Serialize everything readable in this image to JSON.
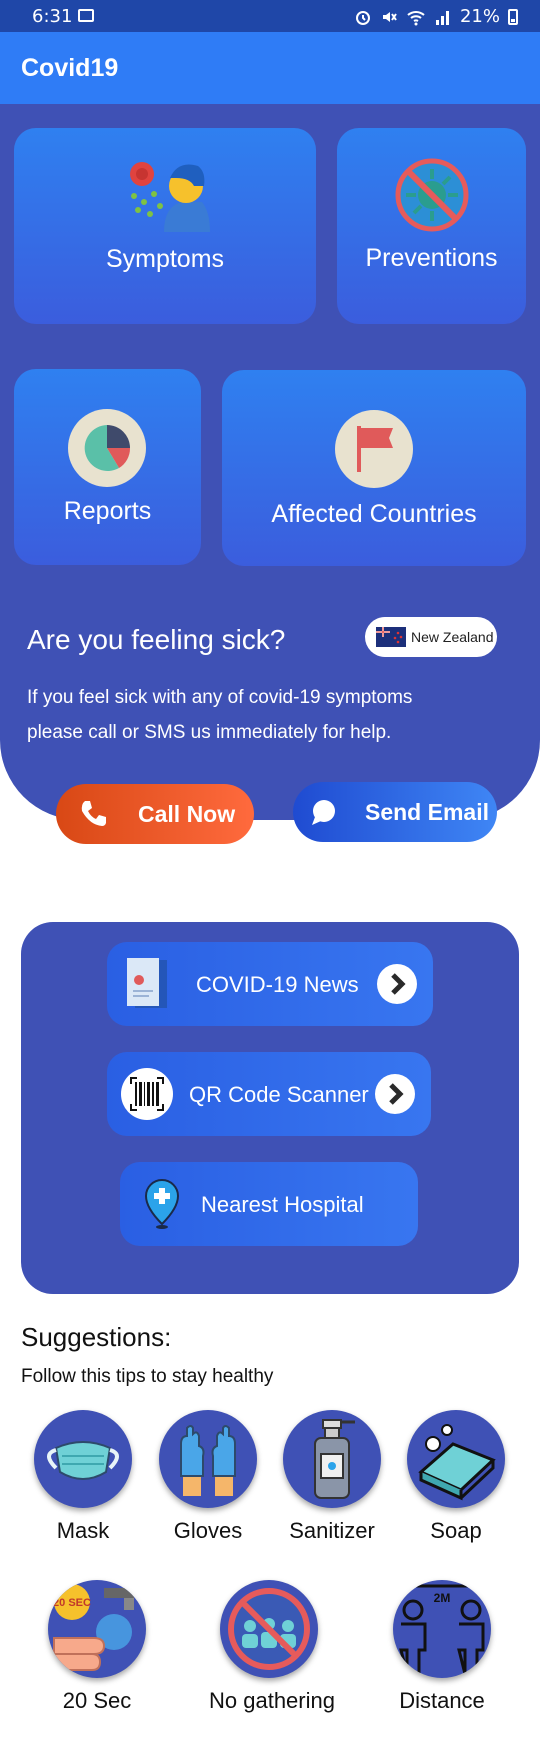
{
  "status_bar": {
    "time": "6:31",
    "battery": "21%"
  },
  "app": {
    "title": "Covid19"
  },
  "cards": {
    "symptoms": "Symptoms",
    "preventions": "Preventions",
    "reports": "Reports",
    "affected": "Affected Countries"
  },
  "sick": {
    "title": "Are you feeling sick?",
    "text": "If you feel sick with any of covid-19 symptoms please call or SMS us immediately for help.",
    "country": "New Zealand"
  },
  "actions": {
    "call": "Call Now",
    "email": "Send Email"
  },
  "panel": {
    "news": "COVID-19 News",
    "qr": "QR Code Scanner",
    "hospital": "Nearest Hospital"
  },
  "suggestions": {
    "title": "Suggestions:",
    "subtitle": "Follow this tips to stay healthy",
    "tips": [
      "Mask",
      "Gloves",
      "Sanitizer",
      "Soap",
      "20 Sec",
      "No gathering",
      "Distance"
    ],
    "icon_text": {
      "sec_badge": "20 SEC",
      "distance_badge": "2M"
    }
  },
  "colors": {
    "primary": "#3f51b5",
    "app_bar": "#2f7cf6",
    "status_bar": "#1f47a8",
    "call": "#ff6a3d"
  }
}
